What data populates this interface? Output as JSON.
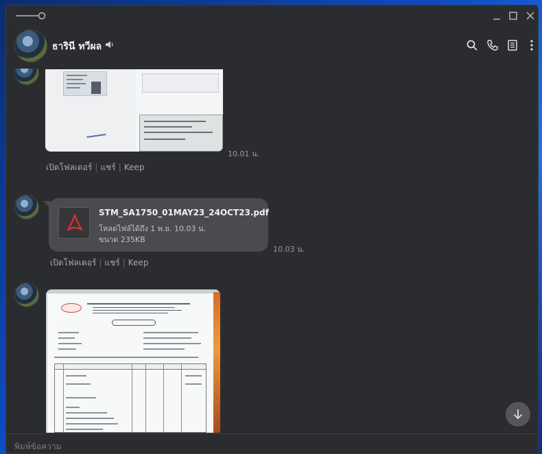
{
  "window": {
    "slider_icon": "slider-icon",
    "controls": [
      "minimize-icon",
      "maximize-icon",
      "close-icon"
    ]
  },
  "header": {
    "contact_name": "ธารินี ทวีผล",
    "icons": [
      "speaker-icon",
      "search-icon",
      "phone-icon",
      "notes-icon",
      "more-vertical-icon"
    ]
  },
  "messages": [
    {
      "type": "image",
      "time": "10.01 น.",
      "actions": [
        "เปิดโฟลเดอร์",
        "แชร์",
        "Keep"
      ]
    },
    {
      "type": "file",
      "file_name": "STM_SA1750_01MAY23_24OCT23.pdf",
      "expire_text": "โหลดไฟล์ได้ถึง 1 พ.ย. 10.03 น.",
      "size_text": "ขนาด 235KB",
      "file_icon": "pdf-icon",
      "time": "10.03 น.",
      "actions": [
        "เปิดโฟลเดอร์",
        "แชร์",
        "Keep"
      ]
    },
    {
      "type": "image"
    }
  ],
  "scroll_button_icon": "arrow-down-icon",
  "composer": {
    "placeholder": "พิมพ์ข้อความ"
  },
  "colors": {
    "window_bg": "#2b2c30",
    "bubble_bg": "#4a4b4f",
    "pdf_red": "#d9302a",
    "desktop_blue": "#0f4bc2"
  }
}
